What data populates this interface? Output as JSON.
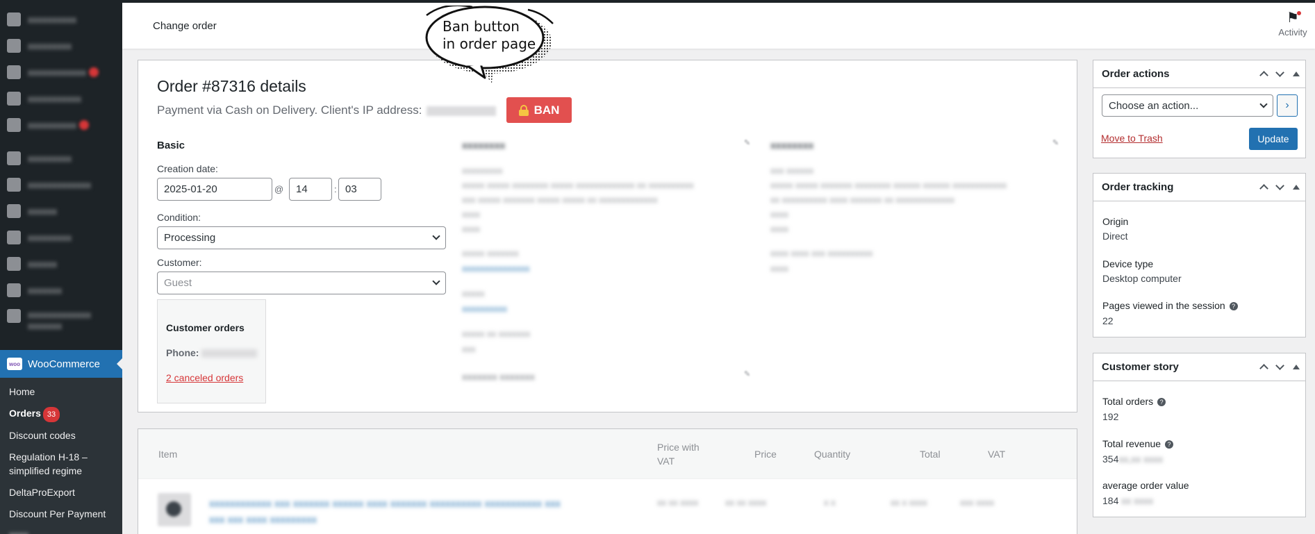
{
  "header": {
    "title": "Change order",
    "activity_label": "Activity"
  },
  "callout": {
    "line1": "Ban button",
    "line2": "in order page"
  },
  "sidebar": {
    "woocommerce_label": "WooCommerce",
    "woo_logo": "woo",
    "submenu": [
      {
        "label": "Home"
      },
      {
        "label": "Orders",
        "count": "33"
      },
      {
        "label": "Discount codes"
      },
      {
        "label": "Regulation H-18 –"
      },
      {
        "label": "simplified regime"
      },
      {
        "label": "DeltaProExport"
      },
      {
        "label": "Discount Per Payment"
      }
    ]
  },
  "order": {
    "heading": "Order #87316 details",
    "payment_text": "Payment via Cash on Delivery. Client's IP address:",
    "ban_label": "BAN",
    "basic_title": "Basic",
    "creation_date_label": "Creation date:",
    "date_value": "2025-01-20",
    "at_sep": "@",
    "hour_value": "14",
    "time_sep": ":",
    "minute_value": "03",
    "condition_label": "Condition:",
    "condition_value": "Processing",
    "customer_label": "Customer:",
    "customer_value": "Guest",
    "customer_orders_title": "Customer orders",
    "phone_label": "Phone:",
    "canceled_orders_link": "2 canceled orders"
  },
  "items_table": {
    "columns": {
      "item": "Item",
      "price_vat_1": "Price with",
      "price_vat_2": "VAT",
      "price": "Price",
      "quantity": "Quantity",
      "total": "Total",
      "vat": "VAT"
    }
  },
  "order_actions": {
    "title": "Order actions",
    "select_value": "Choose an action...",
    "trash_label": "Move to Trash",
    "update_label": "Update",
    "go_label": "›"
  },
  "order_tracking": {
    "title": "Order tracking",
    "origin_label": "Origin",
    "origin_value": "Direct",
    "device_label": "Device type",
    "device_value": "Desktop computer",
    "pages_label": "Pages viewed in the session",
    "pages_value": "22"
  },
  "customer_story": {
    "title": "Customer story",
    "total_orders_label": "Total orders",
    "total_orders_value": "192",
    "total_revenue_label": "Total revenue",
    "total_revenue_value": "354",
    "avg_label": "average order value",
    "avg_value": "184"
  },
  "colors": {
    "ban": "#e2504f",
    "primary": "#2271b1",
    "sidebar": "#1d2327",
    "danger": "#d63638"
  }
}
